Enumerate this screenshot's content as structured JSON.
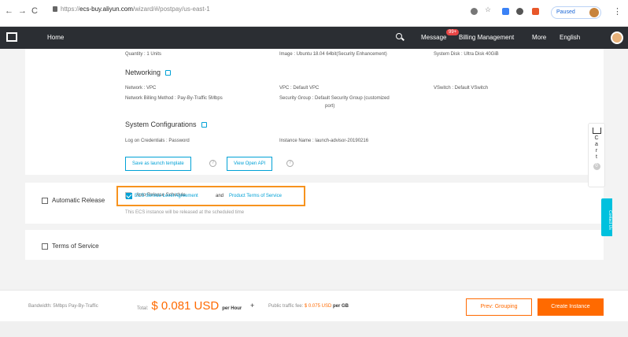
{
  "browser": {
    "url_prefix": "https://",
    "url_domain": "ecs-buy.aliyun.com",
    "url_path": "/wizard/#/postpay/us-east-1",
    "profile_label": "Paused"
  },
  "topbar": {
    "home": "Home",
    "message": "Message",
    "message_badge": "99+",
    "billing": "Billing Management",
    "more": "More",
    "language": "English"
  },
  "summary_top": {
    "quantity": "Quantity : 1 Units",
    "image": "Image : Ubuntu 18.04 64bit(Security Enhancement)",
    "system_disk": "System Disk : Ultra Disk 40GiB"
  },
  "networking": {
    "title": "Networking",
    "network": "Network : VPC",
    "vpc": "VPC : Default VPC",
    "vswitch": "VSwitch : Default VSwitch",
    "billing_method": "Network Billing Method : Pay-By-Traffic 5Mbps",
    "security_group_line1": "Security Group : Default Security Group (customized",
    "security_group_line2": "port)"
  },
  "system_config": {
    "title": "System Configurations",
    "credentials": "Log on Credentials : Password",
    "instance_name": "Instance Name : launch-advisor-20190216",
    "save_template": "Save as launch template",
    "view_api": "View Open API"
  },
  "auto_release": {
    "label": "Automatic Release",
    "checkbox_label": "Auto Release Schedule",
    "hint": "This ECS instance will be released at the scheduled time"
  },
  "terms": {
    "label": "Terms of Service",
    "sla": "ECS Service Level Agreement",
    "and": "and",
    "product_terms": "Product Terms of Service",
    "checked": true
  },
  "cart": {
    "letters": [
      "C",
      "a",
      "r",
      "t"
    ],
    "count": "0"
  },
  "contact": "Contact Us",
  "footer": {
    "bandwidth": "Bandwidth: 5Mbps Pay-By-Traffic",
    "total_label": "Total:",
    "total_amount": "$ 0.081 USD",
    "per_hour": "per Hour",
    "plus": "+",
    "public_fee_label": "Public traffic fee:",
    "public_fee": "$ 0.075 USD",
    "per_gb": "per GB",
    "prev": "Prev: Grouping",
    "create": "Create Instance"
  },
  "colors": {
    "accent": "#00a1d6",
    "orange": "#ff6a00",
    "topbar": "#2b2e33"
  }
}
